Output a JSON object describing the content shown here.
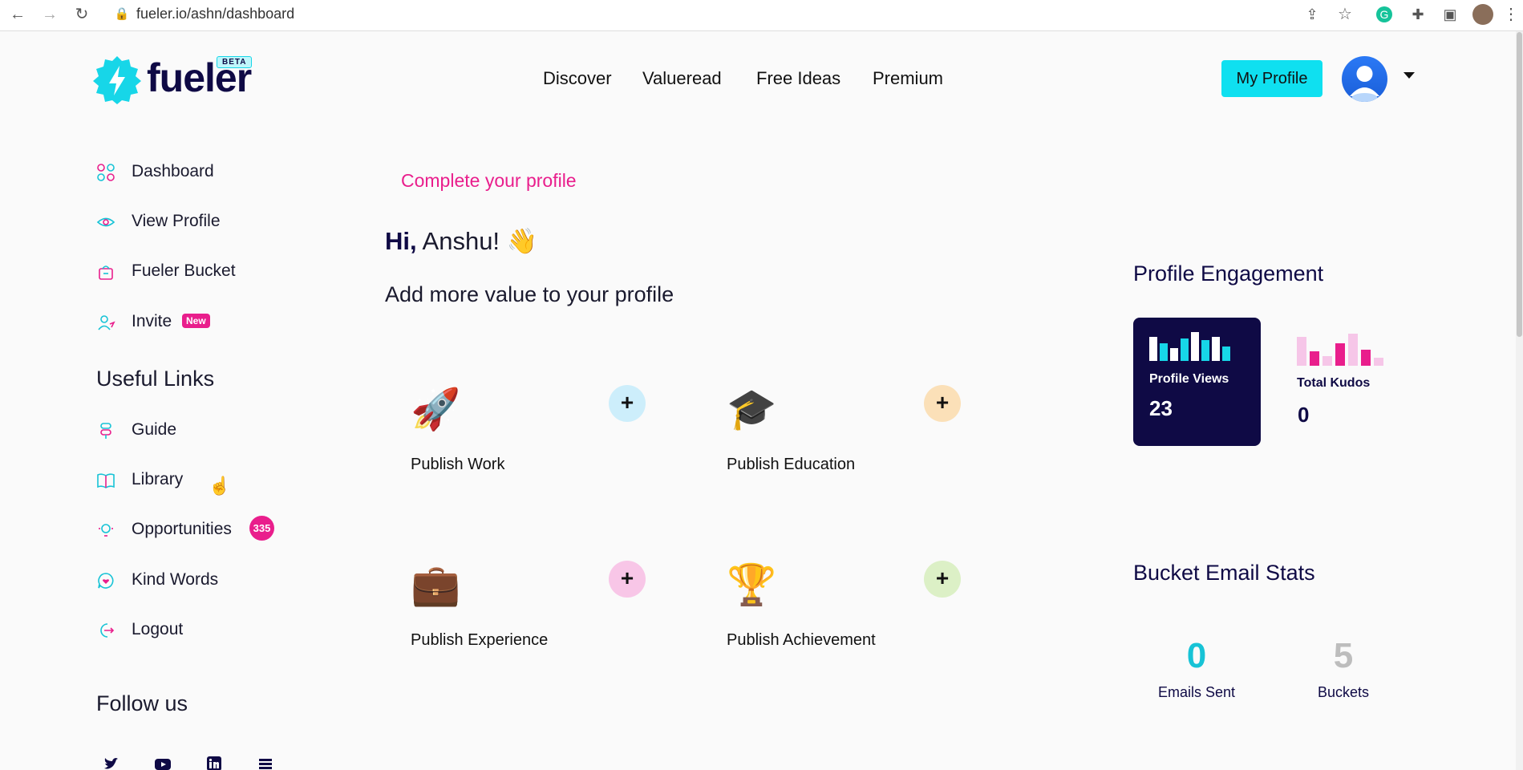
{
  "browser": {
    "url": "fueler.io/ashn/dashboard"
  },
  "header": {
    "logo_text": "fueler",
    "beta_badge": "BETA",
    "nav": [
      "Discover",
      "Valueread",
      "Free Ideas",
      "Premium"
    ],
    "my_profile_label": "My Profile"
  },
  "sidebar": {
    "items": [
      {
        "label": "Dashboard",
        "icon": "grid-icon"
      },
      {
        "label": "View Profile",
        "icon": "eye-icon"
      },
      {
        "label": "Fueler Bucket",
        "icon": "basket-icon"
      },
      {
        "label": "Invite",
        "icon": "user-plus-icon",
        "badge": "New"
      }
    ],
    "useful_links_heading": "Useful Links",
    "links": [
      {
        "label": "Guide",
        "icon": "signpost-icon"
      },
      {
        "label": "Library",
        "icon": "book-icon"
      },
      {
        "label": "Opportunities",
        "icon": "bulb-icon",
        "badge": "335"
      },
      {
        "label": "Kind Words",
        "icon": "heart-chat-icon"
      },
      {
        "label": "Logout",
        "icon": "logout-icon"
      }
    ],
    "follow_heading": "Follow us",
    "social": [
      "twitter-icon",
      "youtube-icon",
      "linkedin-icon",
      "blog-icon"
    ]
  },
  "main": {
    "complete_profile": "Complete your profile",
    "greeting_hi": "Hi,",
    "greeting_name": "Anshu!",
    "greeting_emoji": "👋",
    "subtitle": "Add more value to your profile",
    "cards": [
      {
        "title": "Publish Work",
        "emoji": "🚀",
        "plus": "+",
        "color": "#cdeefb"
      },
      {
        "title": "Publish Education",
        "emoji": "🎓",
        "plus": "+",
        "color": "#fbe0b8"
      },
      {
        "title": "Publish Experience",
        "emoji": "💼",
        "plus": "+",
        "color": "#f8c6e7"
      },
      {
        "title": "Publish Achievement",
        "emoji": "🏆",
        "plus": "+",
        "color": "#dcf0c6"
      }
    ]
  },
  "right": {
    "engagement_heading": "Profile Engagement",
    "profile_views_label": "Profile Views",
    "profile_views_value": "23",
    "total_kudos_label": "Total Kudos",
    "total_kudos_value": "0",
    "bucket_heading": "Bucket Email Stats",
    "emails_sent_value": "0",
    "emails_sent_label": "Emails Sent",
    "buckets_value": "5",
    "buckets_label": "Buckets"
  },
  "colors": {
    "accent_cyan": "#0fe0f0",
    "accent_pink": "#e91e8c",
    "navy": "#0f0a45"
  }
}
